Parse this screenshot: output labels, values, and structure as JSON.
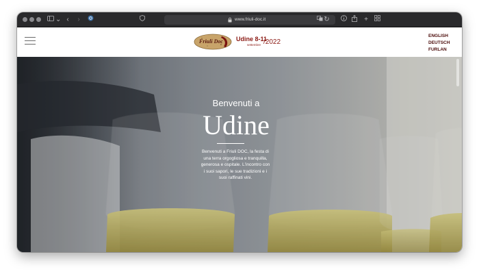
{
  "browser": {
    "url": "www.friuli-doc.it"
  },
  "header": {
    "logo_text": "Friuli Doc",
    "event_title": "Udine 8-11",
    "event_month": "settembre",
    "event_year": "/2022",
    "languages": [
      "ENGLISH",
      "DEUTSCH",
      "FURLAN"
    ]
  },
  "hero": {
    "subtitle": "Benvenuti a",
    "title": "Udine",
    "body": "Benvenuti a Friuli DOC, la festa di una terra orgogliosa e tranquilla, generosa e ospitale. L'incontro con i suoi sapori, le sue tradizioni e i suoi raffinati vini."
  },
  "colors": {
    "brand": "#8b1a14",
    "language_link": "#4a0a08",
    "wine": "#d9cf7a"
  }
}
